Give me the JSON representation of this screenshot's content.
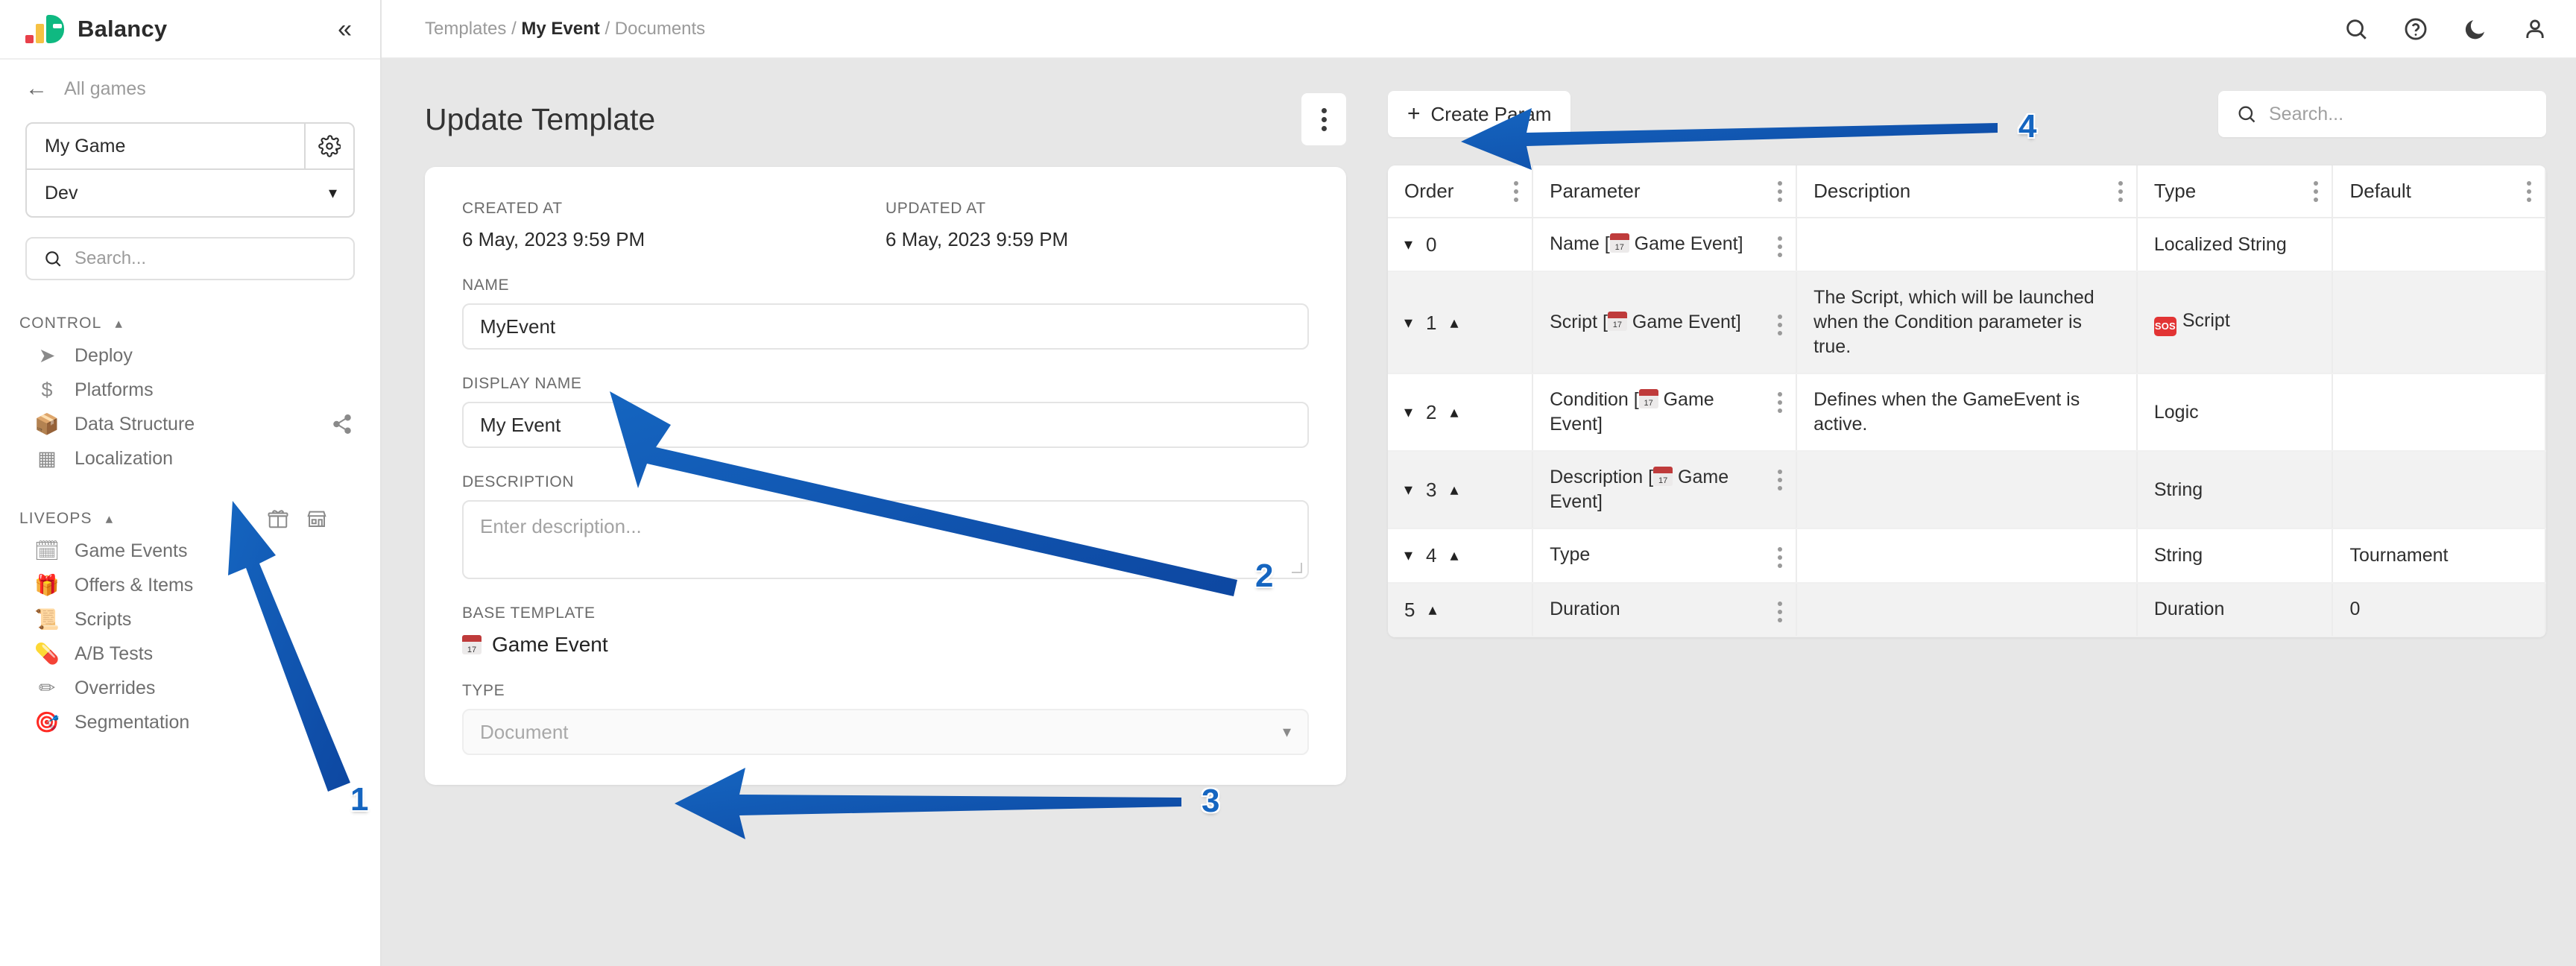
{
  "app": {
    "brand": "Balancy",
    "collapse_icon": "double-chevron-left-icon"
  },
  "sidebar": {
    "back_label": "All games",
    "game": {
      "name": "My Game",
      "settings_icon": "gear-icon"
    },
    "environment": {
      "value": "Dev",
      "chevron": "chevron-down-icon"
    },
    "search_placeholder": "Search...",
    "sections": [
      {
        "title": "CONTROL",
        "collapsed_icon": "chevron-up-icon",
        "items": [
          {
            "label": "Deploy",
            "icon": "paper-plane-icon"
          },
          {
            "label": "Platforms",
            "icon": "dollar-icon"
          },
          {
            "label": "Data Structure",
            "icon": "box-icon"
          },
          {
            "label": "Localization",
            "icon": "blocks-icon"
          }
        ]
      },
      {
        "title": "LIVEOPS",
        "collapsed_icon": "chevron-up-icon",
        "extra_icons": [
          "gift-icon",
          "store-icon"
        ],
        "items": [
          {
            "label": "Game Events",
            "icon": "calendar-emoji"
          },
          {
            "label": "Offers & Items",
            "icon": "gift-emoji"
          },
          {
            "label": "Scripts",
            "icon": "scroll-emoji"
          },
          {
            "label": "A/B Tests",
            "icon": "pill-emoji"
          },
          {
            "label": "Overrides",
            "icon": "pencil-emoji"
          },
          {
            "label": "Segmentation",
            "icon": "dart-emoji"
          }
        ]
      }
    ]
  },
  "topbar": {
    "breadcrumb": {
      "root": "Templates",
      "current": "My Event",
      "leaf": "Documents",
      "separator": "/"
    },
    "icons": [
      "search-icon",
      "help-circle-icon",
      "dark-mode-moon-icon",
      "user-account-icon"
    ]
  },
  "page": {
    "title": "Update Template",
    "kebab_icon": "more-vertical-icon"
  },
  "form": {
    "created_at_label": "CREATED AT",
    "created_at_value": "6 May, 2023 9:59 PM",
    "updated_at_label": "UPDATED AT",
    "updated_at_value": "6 May, 2023 9:59 PM",
    "name_label": "NAME",
    "name_value": "MyEvent",
    "display_name_label": "DISPLAY NAME",
    "display_name_value": "My Event",
    "description_label": "DESCRIPTION",
    "description_placeholder": "Enter description...",
    "base_template_label": "BASE TEMPLATE",
    "base_template_value": "Game Event",
    "type_label": "TYPE",
    "type_value": "Document",
    "type_chevron": "chevron-down-icon"
  },
  "table_toolbar": {
    "create_label": "Create Param",
    "create_plus": "+",
    "search_placeholder": "Search...",
    "search_icon": "search-icon"
  },
  "table": {
    "columns": [
      "Order",
      "Parameter",
      "Description",
      "Type",
      "Default"
    ],
    "rows": [
      {
        "order": "0",
        "order_down": true,
        "order_up": false,
        "parameter": "Name [",
        "parameter_suffix": " Game Event]",
        "parameter_has_calendar": true,
        "description": "",
        "type": "Localized String",
        "type_badge": "",
        "default": ""
      },
      {
        "order": "1",
        "order_down": true,
        "order_up": true,
        "parameter": "Script [",
        "parameter_suffix": " Game Event]",
        "parameter_has_calendar": true,
        "description": "The Script, which will be launched when the Condition parameter is true.",
        "type": "Script",
        "type_badge": "sos",
        "default": ""
      },
      {
        "order": "2",
        "order_down": true,
        "order_up": true,
        "parameter": "Condition [",
        "parameter_suffix": " Game Event]",
        "parameter_has_calendar": true,
        "description": "Defines when the GameEvent is active.",
        "type": "Logic",
        "type_badge": "",
        "default": ""
      },
      {
        "order": "3",
        "order_down": true,
        "order_up": true,
        "parameter": "Description [",
        "parameter_suffix": " Game Event]",
        "parameter_has_calendar": true,
        "description": "",
        "type": "String",
        "type_badge": "",
        "default": ""
      },
      {
        "order": "4",
        "order_down": true,
        "order_up": true,
        "parameter": "Type",
        "parameter_suffix": "",
        "parameter_has_calendar": false,
        "description": "",
        "type": "String",
        "type_badge": "",
        "default": "Tournament"
      },
      {
        "order": "5",
        "order_down": false,
        "order_up": true,
        "parameter": "Duration",
        "parameter_suffix": "",
        "parameter_has_calendar": false,
        "description": "",
        "type": "Duration",
        "type_badge": "",
        "default": "0"
      }
    ]
  },
  "annotations": {
    "color": "#1565c0",
    "markers": [
      {
        "id": "1",
        "label": "1",
        "points_at": "Data Structure"
      },
      {
        "id": "2",
        "label": "2",
        "points_at": "Name field"
      },
      {
        "id": "3",
        "label": "3",
        "points_at": "Base Template"
      },
      {
        "id": "4",
        "label": "4",
        "points_at": "Create Param"
      }
    ]
  }
}
